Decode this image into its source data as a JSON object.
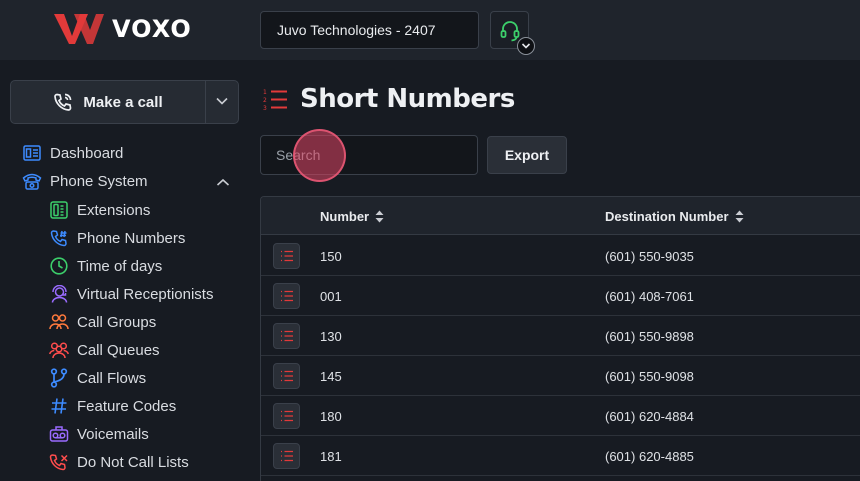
{
  "brand": {
    "name": "VOXO",
    "accent": "#e23a3a"
  },
  "header": {
    "company": "Juvo Technologies - 2407",
    "headset_icon": "headset-icon"
  },
  "sidebar": {
    "make_call_label": "Make a call",
    "items": [
      {
        "label": "Dashboard",
        "icon": "dashboard-icon",
        "color": "#3d8bff"
      },
      {
        "label": "Phone System",
        "icon": "phone-system-icon",
        "color": "#3d8bff"
      },
      {
        "label": "Extensions",
        "icon": "extensions-icon",
        "color": "#3ccf6b"
      },
      {
        "label": "Phone Numbers",
        "icon": "phone-numbers-icon",
        "color": "#3d8bff"
      },
      {
        "label": "Time of days",
        "icon": "clock-icon",
        "color": "#3ccf6b"
      },
      {
        "label": "Virtual Receptionists",
        "icon": "receptionist-icon",
        "color": "#9a6bff"
      },
      {
        "label": "Call Groups",
        "icon": "call-groups-icon",
        "color": "#ff7a3d"
      },
      {
        "label": "Call Queues",
        "icon": "call-queues-icon",
        "color": "#ff4d4d"
      },
      {
        "label": "Call Flows",
        "icon": "call-flows-icon",
        "color": "#3d8bff"
      },
      {
        "label": "Feature Codes",
        "icon": "hash-icon",
        "color": "#3d8bff"
      },
      {
        "label": "Voicemails",
        "icon": "voicemail-icon",
        "color": "#9a6bff"
      },
      {
        "label": "Do Not Call Lists",
        "icon": "do-not-call-icon",
        "color": "#ff4d4d"
      }
    ]
  },
  "main": {
    "title": "Short Numbers",
    "search_placeholder": "Search",
    "search_value": "",
    "export_label": "Export",
    "table": {
      "columns": [
        "Number",
        "Destination Number"
      ],
      "rows": [
        {
          "number": "150",
          "destination": "(601) 550-9035"
        },
        {
          "number": "001",
          "destination": "(601) 408-7061"
        },
        {
          "number": "130",
          "destination": "(601) 550-9898"
        },
        {
          "number": "145",
          "destination": "(601) 550-9098"
        },
        {
          "number": "180",
          "destination": "(601) 620-4884"
        },
        {
          "number": "181",
          "destination": "(601) 620-4885"
        }
      ]
    }
  }
}
